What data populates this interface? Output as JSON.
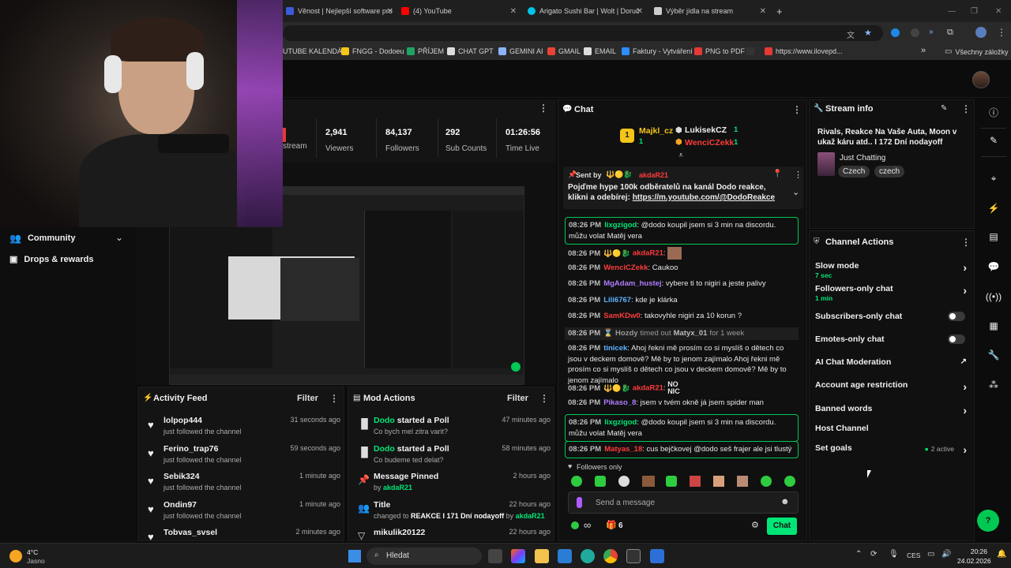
{
  "browser": {
    "tabs": [
      {
        "label": "Věnost | Nejlepší software pro",
        "color": "#3a5bd9"
      },
      {
        "label": "(4) YouTube",
        "color": "#ff0000"
      },
      {
        "label": "Arigato Sushi Bar | Wolt | Doruč",
        "color": "#00c2e8"
      },
      {
        "label": "Výběr jídla na stream",
        "color": "#cccccc"
      }
    ],
    "new_tab": "+",
    "bookmarks": [
      {
        "label": "UTUBE KALENDÁŘ",
        "color": "#555555"
      },
      {
        "label": "FNGG - Dodoeu",
        "color": "#f5c518"
      },
      {
        "label": "PŘÍJEM",
        "color": "#1fa463"
      },
      {
        "label": "CHAT GPT",
        "color": "#dddddd"
      },
      {
        "label": "GEMINI AI",
        "color": "#8ab4f8"
      },
      {
        "label": "GMAIL",
        "color": "#ea4335"
      },
      {
        "label": "EMAIL",
        "color": "#dddddd"
      },
      {
        "label": "Faktury - Vytváření",
        "color": "#2d8cff"
      },
      {
        "label": "PNG to PDF",
        "color": "#e53935"
      },
      {
        "label": "",
        "color": "#333333"
      },
      {
        "label": "https://www.ilovepd...",
        "color": "#e53935"
      }
    ],
    "bookmarks_more": "»",
    "all_bookmarks": "Všechny záložky"
  },
  "sidebar": {
    "items": [
      {
        "label": "Community",
        "icon": "community-icon"
      },
      {
        "label": "Drops & rewards",
        "icon": "drops-icon"
      }
    ]
  },
  "stats": {
    "partial_label": "stream",
    "items": [
      {
        "value": "2,941",
        "label": "Viewers"
      },
      {
        "value": "84,137",
        "label": "Followers"
      },
      {
        "value": "292",
        "label": "Sub Counts"
      },
      {
        "value": "01:26:56",
        "label": "Time Live"
      }
    ]
  },
  "activity_feed": {
    "title": "Activity Feed",
    "filter": "Filter",
    "items": [
      {
        "name": "lolpop444",
        "sub": "just followed the channel",
        "time": "31 seconds ago"
      },
      {
        "name": "Ferino_trap76",
        "sub": "just followed the channel",
        "time": "59 seconds ago"
      },
      {
        "name": "Sebik324",
        "sub": "just followed the channel",
        "time": "1 minute ago"
      },
      {
        "name": "Ondin97",
        "sub": "just followed the channel",
        "time": "1 minute ago"
      },
      {
        "name": "Tobvas_svsel",
        "sub": "",
        "time": "2 minutes ago"
      }
    ]
  },
  "mod_actions": {
    "title": "Mod Actions",
    "filter": "Filter",
    "items": [
      {
        "actor": "Dodo",
        "action": " started a Poll",
        "sub": "Co bych mel zitra varit?",
        "time": "47 minutes ago",
        "icon": "poll-icon"
      },
      {
        "actor": "Dodo",
        "action": " started a Poll",
        "sub": "Co budeme ted delat?",
        "time": "58 minutes ago",
        "icon": "poll-icon"
      },
      {
        "actor": "",
        "action": "Message Pinned",
        "sub_prefix": "by ",
        "sub_user": "akdaR21",
        "time": "2 hours ago",
        "icon": "pin-icon"
      },
      {
        "actor": "",
        "action": "Title",
        "sub_prefix": "changed to ",
        "sub_bold": "REAKCE I 171 Dní nodayoff",
        "sub_by": " by ",
        "sub_user": "akdaR21",
        "time": "22 hours ago",
        "icon": "title-icon"
      },
      {
        "actor": "",
        "action": "mikulik20122",
        "sub": "",
        "time": "22 hours ago",
        "icon": "chevron-down-icon"
      }
    ]
  },
  "chat": {
    "title": "Chat",
    "leaderboard": [
      {
        "name": "Majkl_cz",
        "count": "1",
        "rank": "1"
      },
      {
        "name": "LukisekCZ",
        "count": "1"
      },
      {
        "name": "WenciCZekk",
        "count": "1"
      }
    ],
    "pinned": {
      "sent_by": "Sent by",
      "user": "akdaR21",
      "text": "Pojďme hype 100k odběratelů na kanál Dodo reakce, klikni a odebírej: ",
      "link": "https://m.youtube.com/@DodoReakce"
    },
    "messages": [
      {
        "time": "08:26 PM",
        "user": "lixgzigod",
        "color": "#00e676",
        "text": "@dodo koupil jsem si 3 min na discordu. můžu volat Matěj vera",
        "highlight": true
      },
      {
        "time": "08:26 PM",
        "user": "akdaR21",
        "color": "#ff3b3b",
        "text": "",
        "emote": true
      },
      {
        "time": "08:26 PM",
        "user": "WenciCZekk",
        "color": "#ff3b3b",
        "text": "Caukoo"
      },
      {
        "time": "08:26 PM",
        "user": "MgAdam_hustej",
        "color": "#b07cff",
        "text": "vybere ti to nigiri a jeste palivy"
      },
      {
        "time": "08:26 PM",
        "user": "Lili6767",
        "color": "#5ab4ff",
        "text": "kde je klárka"
      },
      {
        "time": "08:26 PM",
        "user": "SamKDw0",
        "color": "#ff3b3b",
        "text": "takovyhle nigiri za 10 korun ?"
      },
      {
        "time": "08:26 PM",
        "user": "Hozdy",
        "color": "#9a9a9a",
        "text": "timed out",
        "target": "Matyx_01",
        "extra": "for 1 week",
        "timeout": true
      },
      {
        "time": "08:26 PM",
        "user": "tinicek",
        "color": "#5ab4ff",
        "text": "Ahoj řekni mě prosím co si myslíš o dětech co jsou v deckem domově? Mě by to jenom zajímalo Ahoj řekni mě prosím co si myslíš o dětech co jsou v deckem domově? Mě by to jenom zajímalo"
      },
      {
        "time": "08:26 PM",
        "user": "akdaR21",
        "color": "#ff3b3b",
        "text": "NO NIC",
        "emote_text": true
      },
      {
        "time": "08:26 PM",
        "user": "Pikaso_8",
        "color": "#b07cff",
        "text": "jsem v tvém okně já jsem spider man"
      },
      {
        "time": "08:26 PM",
        "user": "lixgzigod",
        "color": "#00e676",
        "text": "@dodo koupil jsem si 3 min na discordu. můžu volat Matěj vera",
        "highlight": true
      },
      {
        "time": "08:26 PM",
        "user": "Matyas_18",
        "color": "#ff3b3b",
        "text": "cus bejčkovej @dodo seš frajer ale jsi tlustý",
        "highlight": true
      }
    ],
    "followers_only": "Followers only",
    "input_placeholder": "Send a message",
    "points": "∞",
    "gift_count": "6",
    "send_button": "Chat"
  },
  "stream_info": {
    "title": "Stream info",
    "stream_title": "Rivals, Reakce Na Vaše Auta, Moon v ukaž káru atd.. I 172 Dní nodayoff",
    "category": "Just Chatting",
    "tags": [
      "Czech",
      "czech"
    ]
  },
  "channel_actions": {
    "title": "Channel Actions",
    "items": [
      {
        "label": "Slow mode",
        "sub": "7 sec",
        "control": "chevron"
      },
      {
        "label": "Followers-only chat",
        "sub": "1 min",
        "control": "chevron"
      },
      {
        "label": "Subscribers-only chat",
        "sub": "",
        "control": "toggle"
      },
      {
        "label": "Emotes-only chat",
        "sub": "",
        "control": "toggle"
      },
      {
        "label": "AI Chat Moderation",
        "sub": "",
        "control": "external"
      },
      {
        "label": "Account age restriction",
        "sub": "",
        "control": "chevron"
      },
      {
        "label": "Banned words",
        "sub": "",
        "control": "chevron"
      },
      {
        "label": "Host Channel",
        "sub": "",
        "control": "none"
      },
      {
        "label": "Set goals",
        "sub": "",
        "control": "chevron",
        "status": "2 active"
      }
    ]
  },
  "taskbar": {
    "weather_temp": "4°C",
    "weather_desc": "Jasno",
    "search_placeholder": "Hledat",
    "lang": "CES",
    "time": "20:26",
    "date": "24.02.2026"
  },
  "colors": {
    "accent": "#00e676",
    "red_user": "#ff3b3b",
    "panel": "#141414"
  }
}
